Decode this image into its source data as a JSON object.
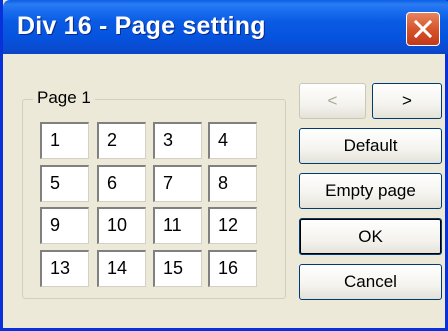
{
  "window": {
    "title": "Div 16 - Page setting"
  },
  "group": {
    "label": "Page 1"
  },
  "cells": [
    "1",
    "2",
    "3",
    "4",
    "5",
    "6",
    "7",
    "8",
    "9",
    "10",
    "11",
    "12",
    "13",
    "14",
    "15",
    "16"
  ],
  "buttons": {
    "prev": "<",
    "next": ">",
    "default": "Default",
    "empty_page": "Empty page",
    "ok": "OK",
    "cancel": "Cancel"
  },
  "icons": {
    "close": "close-icon"
  },
  "colors": {
    "titlebar": "#0a5be4",
    "close_button": "#d8552b",
    "window_bg": "#ece9d8"
  }
}
